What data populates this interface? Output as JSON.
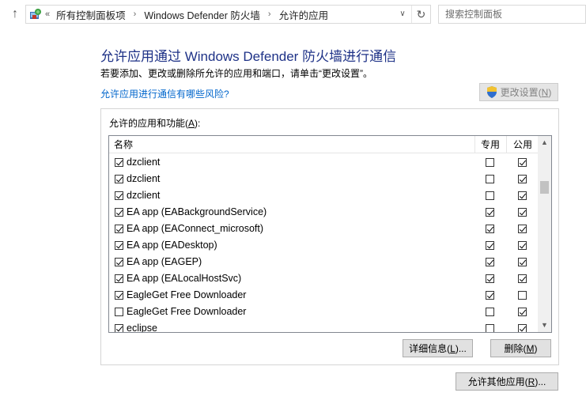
{
  "address_bar": {
    "lead_chevron": "«",
    "breadcrumbs": [
      "所有控制面板项",
      "Windows Defender 防火墙",
      "允许的应用"
    ],
    "separator": "›",
    "search_placeholder": "搜索控制面板"
  },
  "header": {
    "title": "允许应用通过 Windows Defender 防火墙进行通信",
    "description": "若要添加、更改或删除所允许的应用和端口，请单击“更改设置”。",
    "risk_link": "允许应用进行通信有哪些风险?",
    "change_settings_label": "更改设置",
    "change_settings_key": "N"
  },
  "group": {
    "label": "允许的应用和功能",
    "label_key": "A",
    "columns": {
      "name": "名称",
      "private": "专用",
      "public": "公用"
    },
    "rows": [
      {
        "name": "dzclient",
        "enabled": true,
        "private": false,
        "public": true
      },
      {
        "name": "dzclient",
        "enabled": true,
        "private": false,
        "public": true
      },
      {
        "name": "dzclient",
        "enabled": true,
        "private": false,
        "public": true
      },
      {
        "name": "EA app (EABackgroundService)",
        "enabled": true,
        "private": true,
        "public": true
      },
      {
        "name": "EA app (EAConnect_microsoft)",
        "enabled": true,
        "private": true,
        "public": true
      },
      {
        "name": "EA app (EADesktop)",
        "enabled": true,
        "private": true,
        "public": true
      },
      {
        "name": "EA app (EAGEP)",
        "enabled": true,
        "private": true,
        "public": true
      },
      {
        "name": "EA app (EALocalHostSvc)",
        "enabled": true,
        "private": true,
        "public": true
      },
      {
        "name": "EagleGet Free Downloader",
        "enabled": true,
        "private": true,
        "public": false
      },
      {
        "name": "EagleGet Free Downloader",
        "enabled": false,
        "private": false,
        "public": true
      },
      {
        "name": "eclipse",
        "enabled": true,
        "private": false,
        "public": true
      }
    ],
    "details_label": "详细信息",
    "details_key": "L",
    "delete_label": "删除",
    "delete_key": "M"
  },
  "allow_other": {
    "label": "允许其他应用",
    "key": "R"
  },
  "colors": {
    "title": "#1e3287",
    "link": "#0066cc",
    "disabled_text": "#838383"
  },
  "icons": [
    "up-arrow-icon",
    "control-panel-icon",
    "chevron-down-icon",
    "refresh-icon",
    "shield-icon",
    "scroll-up-icon",
    "scroll-down-icon"
  ]
}
